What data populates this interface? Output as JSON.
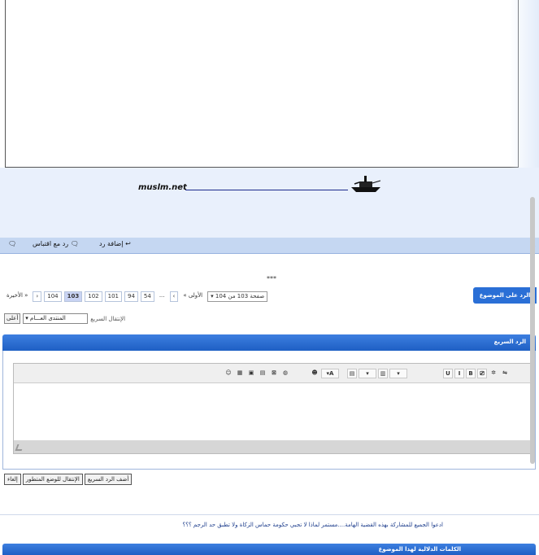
{
  "signature": {
    "text": "muslm.net"
  },
  "post_actions": {
    "add_reply": "إضافة رد",
    "reply_with_quote": "رد مع اقتباس",
    "reply_topic": "الرد على الموضوع"
  },
  "stars": "***",
  "pager": {
    "last": "الأخيرة",
    "pages": [
      "104",
      "103",
      "102",
      "101",
      "94",
      "54"
    ],
    "current": "103",
    "ellipsis": "...",
    "first": "الأولى",
    "page_of": "صفحة 103 من 104"
  },
  "quicknav": {
    "go_button": "أعلى",
    "forum_value": "المنتدى العـــام",
    "label": "الإنتقال السريع"
  },
  "quick_reply": {
    "title": "الرد السريع",
    "toolbar": [
      "B",
      "I",
      "U",
      "A"
    ]
  },
  "submit": {
    "post_quick_reply": "أضف الرد السريع",
    "go_advanced": "الإنتقال للوضع المتطور",
    "cancel": "إلغاء"
  },
  "topic_text": "ادعوا الجميع للمشاركة بهذه القضية الهامة....مستمر   لماذا لا تجبي حكومة حماس الزكاة ولا تطبق حد الرجم ؟؟؟",
  "links_header": "الكلمات الدلالية لهذا الموضوع"
}
